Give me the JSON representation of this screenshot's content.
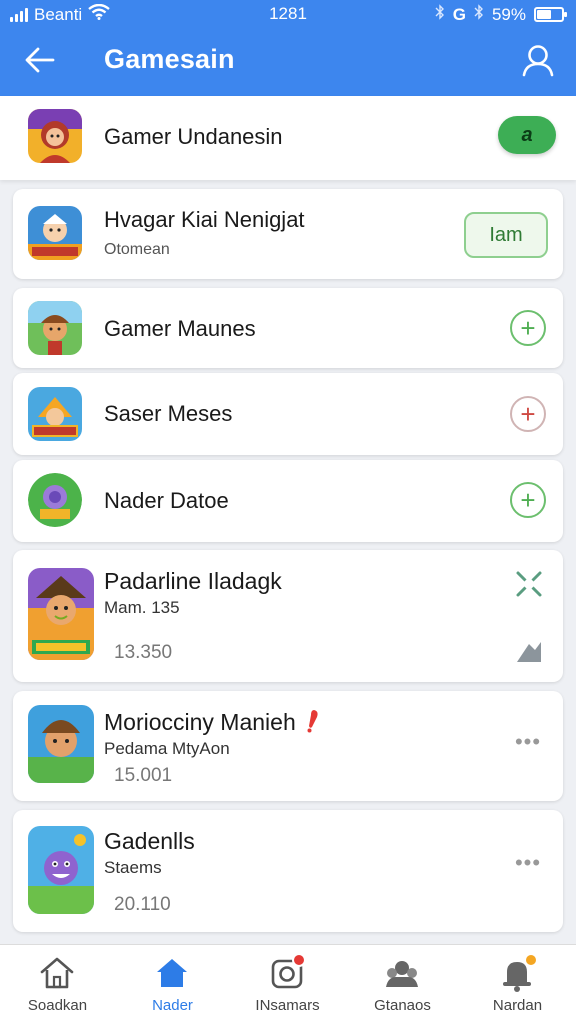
{
  "colors": {
    "app_bar": "#3d86ee",
    "accent_green": "#3dae55",
    "active_nav": "#2d7ce7",
    "badge_red": "#e53935"
  },
  "status_bar": {
    "carrier": "Beanti",
    "time": "1281",
    "battery": "59%",
    "battery_level": 0.59,
    "icons": [
      "signal-icon",
      "wifi-icon",
      "bluetooth-icon",
      "g-icon",
      "bluetooth-icon",
      "battery-icon"
    ]
  },
  "app_bar": {
    "title": "Gamesain",
    "back_icon": "arrow-left-icon",
    "profile_icon": "user-icon"
  },
  "header_row": {
    "title": "Gamer Undanesin",
    "toggle_label": "a"
  },
  "items": [
    {
      "title": "Hvagar Kiai Nenigjat",
      "subtitle": "Otomean",
      "action": "Iam"
    },
    {
      "title": "Gamer Maunes",
      "action_icon": "plus-icon"
    },
    {
      "title": "Saser Meses",
      "action_icon": "plus-icon"
    },
    {
      "title": "Nader Datoe",
      "action_icon": "plus-icon"
    },
    {
      "title": "Padarline Iladagk",
      "subtitle": "Mam. 135",
      "meta": "13.350",
      "action_icon": "x-icon",
      "secondary_icon": "tool-icon"
    },
    {
      "title": "Moriocciny Manieh",
      "subtitle": "Pedama MtyAon",
      "meta": "15.001",
      "action_icon": "more-icon"
    },
    {
      "title": "Gadenlls",
      "subtitle": "Staems",
      "meta": "20.110",
      "action_icon": "more-icon"
    }
  ],
  "bottom_nav": [
    {
      "label": "Soadkan",
      "icon": "home-icon",
      "active": false
    },
    {
      "label": "Nader",
      "icon": "home-filled-icon",
      "active": true
    },
    {
      "label": "INsamars",
      "icon": "camera-icon",
      "active": false,
      "badge": true
    },
    {
      "label": "Gtanaos",
      "icon": "group-icon",
      "active": false
    },
    {
      "label": "Nardan",
      "icon": "bell-icon",
      "active": false,
      "badge": true
    }
  ]
}
